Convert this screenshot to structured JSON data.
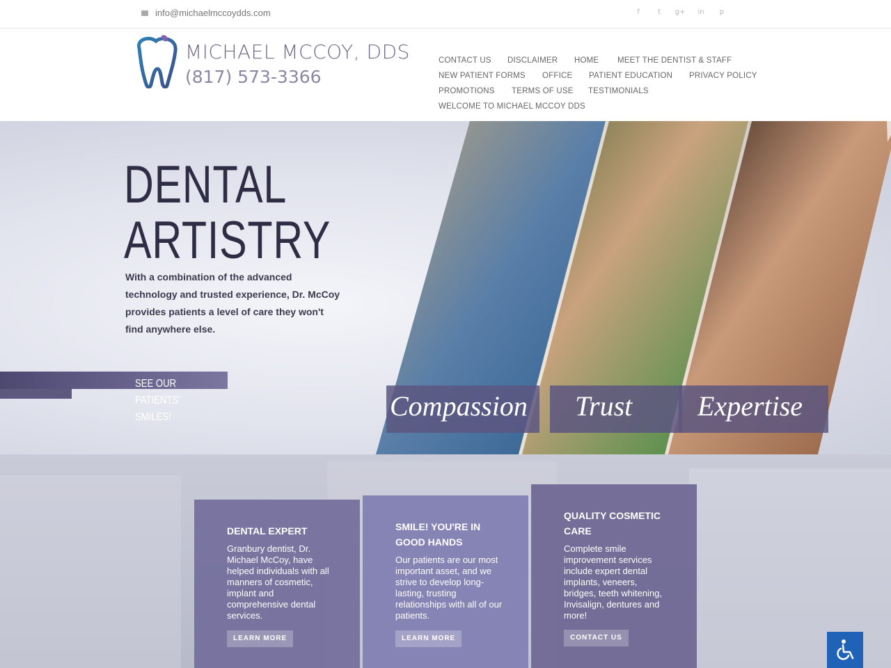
{
  "topbar": {
    "email": "info@michaelmccoydds.com",
    "social_icons": [
      "facebook-icon",
      "twitter-icon",
      "google-plus-icon",
      "linkedin-icon",
      "pinterest-icon"
    ],
    "social_glyphs": [
      "f",
      "t",
      "g+",
      "in",
      "p"
    ]
  },
  "header": {
    "brand_name": "MICHAEL MCCOY, DDS",
    "phone": "(817) 573-3366",
    "nav": [
      "CONTACT US",
      "DISCLAIMER",
      "HOME",
      "MEET THE DENTIST & STAFF",
      "NEW PATIENT FORMS",
      "OFFICE",
      "PATIENT EDUCATION",
      "PRIVACY POLICY",
      "PROMOTIONS",
      "TERMS OF USE",
      "TESTIMONIALS",
      "WELCOME TO MICHAEL MCCOY DDS"
    ]
  },
  "hero": {
    "title_line1": "DENTAL",
    "title_line2": "ARTISTRY",
    "text": "With a combination of the advanced technology and trusted experience, Dr. McCoy provides patients a level of care they won't find anywhere else.",
    "cta": "SEE OUR PATIENTS' SMILES!",
    "captions": [
      "Compassion",
      "Trust",
      "Expertise"
    ]
  },
  "features": [
    {
      "title": "DENTAL EXPERT",
      "text": "Granbury dentist, Dr. Michael McCoy, have helped individuals with all manners of cosmetic, implant and comprehensive dental services.",
      "button": "LEARN MORE"
    },
    {
      "title": "SMILE! YOU'RE IN GOOD HANDS",
      "text": "Our patients are our most important asset, and we strive to develop long-lasting, trusting relationships with all of our patients.",
      "button": "LEARN MORE"
    },
    {
      "title": "QUALITY COSMETIC CARE",
      "text": "Complete smile improvement services include expert dental implants, veneers, bridges, teeth whitening, Invisalign, dentures and more!",
      "button": "CONTACT US"
    }
  ],
  "colors": {
    "accent": "#6e6a9a",
    "title": "#2f2d45",
    "accessibility": "#1e63b8"
  }
}
